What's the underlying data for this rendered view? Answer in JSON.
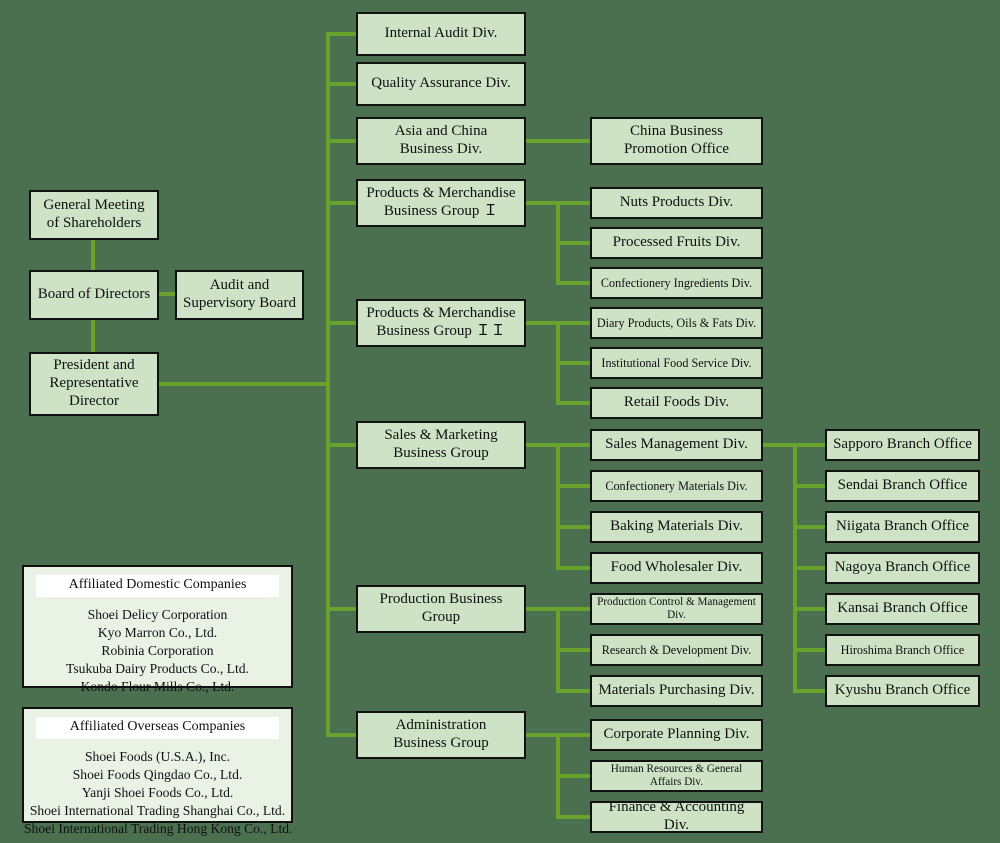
{
  "colors": {
    "background": "#4a7050",
    "box_fill": "#cee3c5",
    "box_border": "#111111",
    "connector": "#6aa22e",
    "panel_fill": "#eaf2e6",
    "panel_header_fill": "#ffffff"
  },
  "governance": {
    "shareholders": "General Meeting\nof Shareholders",
    "shareholders_line1": "General Meeting",
    "shareholders_line2": "of Shareholders",
    "board": "Board of Directors",
    "audit_line1": "Audit and",
    "audit_line2": "Supervisory Board",
    "president_line1": "President and",
    "president_line2": "Representative",
    "president_line3": "Director"
  },
  "divisions": {
    "internal_audit": "Internal Audit Div.",
    "quality_assurance": "Quality Assurance Div.",
    "asia_china_line1": "Asia and China",
    "asia_china_line2": "Business Div.",
    "china_promotion_line1": "China Business",
    "china_promotion_line2": "Promotion Office"
  },
  "groups": [
    {
      "id": "pm1",
      "line1": "Products & Merchandise",
      "line2": "Business Group Ｉ",
      "children": [
        {
          "label": "Nuts Products Div.",
          "size": "normal"
        },
        {
          "label": "Processed Fruits Div.",
          "size": "normal"
        },
        {
          "label": "Confectionery Ingredients Div.",
          "size": "sm"
        }
      ]
    },
    {
      "id": "pm2",
      "line1": "Products & Merchandise",
      "line2": "Business Group ＩＩ",
      "children": [
        {
          "label": "Diary Products, Oils & Fats Div.",
          "size": "sm"
        },
        {
          "label": "Institutional Food Service Div.",
          "size": "sm"
        },
        {
          "label": "Retail Foods Div.",
          "size": "normal"
        }
      ]
    },
    {
      "id": "sales",
      "line1": "Sales & Marketing",
      "line2": "Business Group",
      "children": [
        {
          "label": "Sales Management Div.",
          "size": "normal"
        },
        {
          "label": "Confectionery Materials Div.",
          "size": "sm"
        },
        {
          "label": "Baking Materials Div.",
          "size": "normal"
        },
        {
          "label": "Food Wholesaler Div.",
          "size": "normal"
        }
      ]
    },
    {
      "id": "production",
      "line1": "Production Business",
      "line2": "Group",
      "children": [
        {
          "label": "Production Control & Management Div.",
          "size": "xs"
        },
        {
          "label": "Research & Development Div.",
          "size": "sm"
        },
        {
          "label": "Materials Purchasing Div.",
          "size": "normal"
        }
      ]
    },
    {
      "id": "admin",
      "line1": "Administration",
      "line2": "Business Group",
      "children": [
        {
          "label": "Corporate Planning Div.",
          "size": "normal"
        },
        {
          "label": "Human Resources & General Affairs Div.",
          "size": "xs"
        },
        {
          "label": "Finance  &  Accounting Div.",
          "size": "normal"
        }
      ]
    }
  ],
  "branch_offices": [
    "Sapporo Branch Office",
    "Sendai Branch Office",
    "Niigata Branch Office",
    "Nagoya Branch Office",
    "Kansai Branch Office",
    "Hiroshima Branch Office",
    "Kyushu Branch Office"
  ],
  "affiliated_domestic": {
    "title": "Affiliated Domestic Companies",
    "items": [
      "Shoei Delicy Corporation",
      "Kyo Marron Co., Ltd.",
      "Robinia Corporation",
      "Tsukuba Dairy Products Co., Ltd.",
      "Kondo Flour Mills Co., Ltd."
    ]
  },
  "affiliated_overseas": {
    "title": "Affiliated Overseas Companies",
    "items": [
      "Shoei Foods (U.S.A.), Inc.",
      "Shoei Foods Qingdao Co., Ltd.",
      "Yanji Shoei Foods Co., Ltd.",
      "Shoei International Trading Shanghai Co., Ltd.",
      "Shoei International Trading Hong Kong Co., Ltd."
    ]
  }
}
